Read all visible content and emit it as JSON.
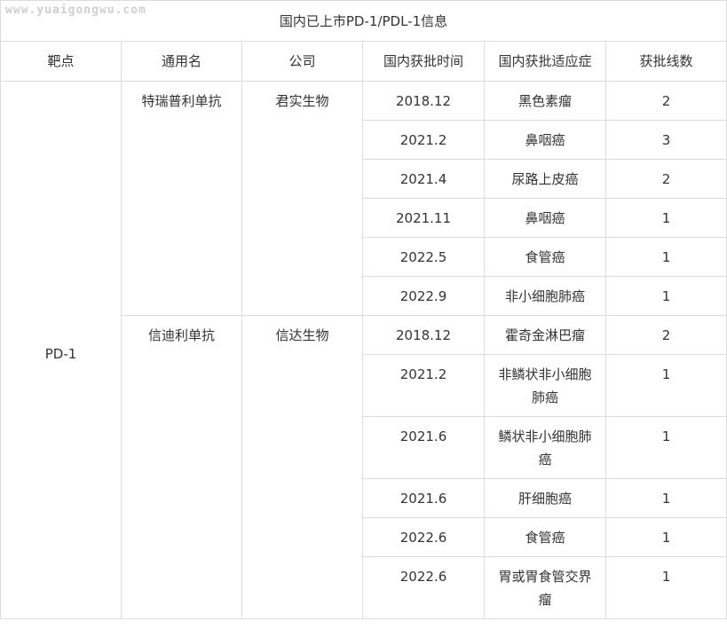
{
  "watermark": "www.yuaigongwu.com",
  "table": {
    "title": "国内已上市PD-1/PDL-1信息",
    "headers": {
      "target": "靶点",
      "generic_name": "通用名",
      "company": "公司",
      "approval_time": "国内获批时间",
      "indication": "国内获批适应症",
      "line": "获批线数"
    },
    "target_value": "PD-1",
    "drugs": [
      {
        "generic_name": "特瑞普利单抗",
        "company": "君实生物",
        "rows": [
          {
            "time": "2018.12",
            "indication": "黑色素瘤",
            "line": "2"
          },
          {
            "time": "2021.2",
            "indication": "鼻咽癌",
            "line": "3"
          },
          {
            "time": "2021.4",
            "indication": "尿路上皮癌",
            "line": "2"
          },
          {
            "time": "2021.11",
            "indication": "鼻咽癌",
            "line": "1"
          },
          {
            "time": "2022.5",
            "indication": "食管癌",
            "line": "1"
          },
          {
            "time": "2022.9",
            "indication": "非小细胞肺癌",
            "line": "1"
          }
        ]
      },
      {
        "generic_name": "信迪利单抗",
        "company": "信达生物",
        "rows": [
          {
            "time": "2018.12",
            "indication": "霍奇金淋巴瘤",
            "line": "2"
          },
          {
            "time": "2021.2",
            "indication": "非鳞状非小细胞肺癌",
            "line": "1"
          },
          {
            "time": "2021.6",
            "indication": "鳞状非小细胞肺癌",
            "line": "1"
          },
          {
            "time": "2021.6",
            "indication": "肝细胞癌",
            "line": "1"
          },
          {
            "time": "2022.6",
            "indication": "食管癌",
            "line": "1"
          },
          {
            "time": "2022.6",
            "indication": "胃或胃食管交界瘤",
            "line": "1"
          }
        ]
      }
    ]
  }
}
